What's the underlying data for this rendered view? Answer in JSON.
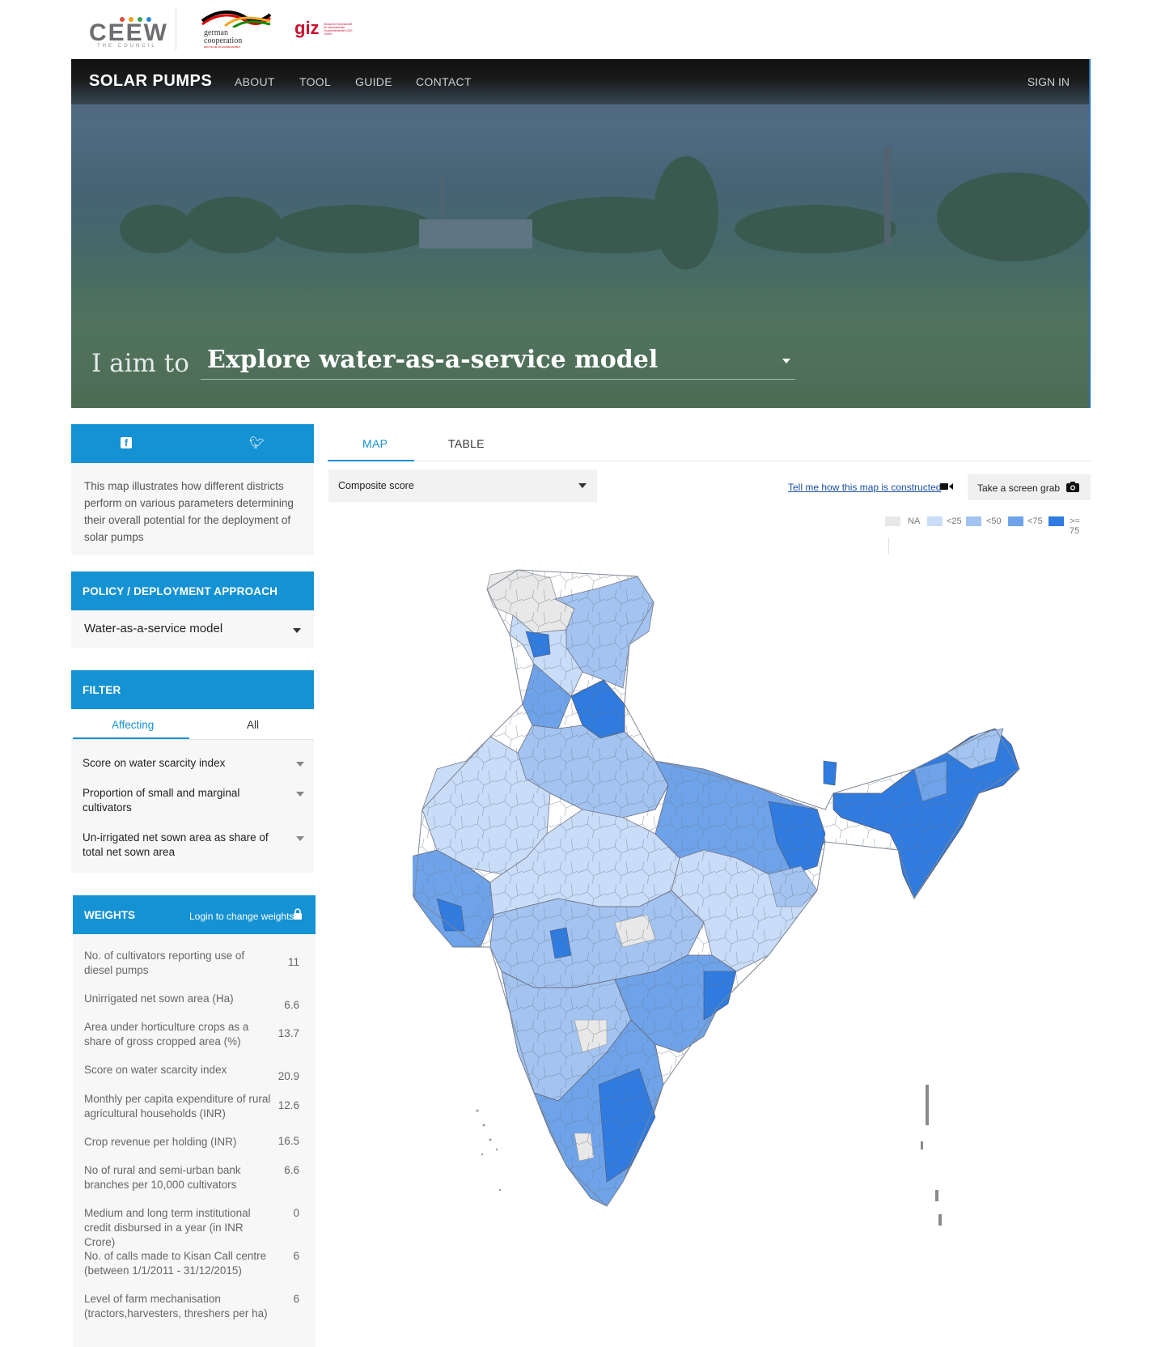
{
  "logos": {
    "ceew_word": "CEEW",
    "ceew_sub": "THE COUNCIL",
    "german_line1": "german",
    "german_line2": "cooperation",
    "german_small": "DEUTSCHE ZUSAMMENARBEIT",
    "giz_word": "giz",
    "giz_small": "Deutsche Gesellschaft für Internationale Zusammenarbeit (GIZ) GmbH"
  },
  "nav": {
    "brand": "SOLAR PUMPS",
    "items": [
      "ABOUT",
      "TOOL",
      "GUIDE",
      "CONTACT"
    ],
    "signin": "SIGN IN"
  },
  "hero": {
    "prefix": "I aim to",
    "selected_goal": "Explore water-as-a-service model"
  },
  "share": {
    "facebook_icon": "facebook-icon",
    "twitter_icon": "twitter-icon"
  },
  "intro_text": "This map illustrates how different districts perform on various parameters determining their overall potential for the deployment of solar pumps",
  "policy": {
    "heading": "POLICY / DEPLOYMENT APPROACH",
    "selected": "Water-as-a-service model"
  },
  "filter": {
    "heading": "FILTER",
    "tabs": [
      "Affecting",
      "All"
    ],
    "active_tab": "Affecting",
    "items": [
      "Score on water scarcity index",
      "Proportion of small and marginal cultivators",
      "Un-irrigated net sown area as share of total net sown area"
    ]
  },
  "weights": {
    "heading": "WEIGHTS",
    "login_label": "Login to change weights",
    "items": [
      {
        "label": "No. of cultivators reporting use of diesel pumps",
        "value": "11"
      },
      {
        "label": "Unirrigated net sown area (Ha)",
        "value": "6.6"
      },
      {
        "label": "Area under horticulture crops as a share of gross cropped area (%)",
        "value": "13.7"
      },
      {
        "label": "Score on water scarcity index",
        "value": "20.9"
      },
      {
        "label": "Monthly per capita expenditure of rural agricultural households (INR)",
        "value": "12.6"
      },
      {
        "label": "Crop revenue per holding (INR)",
        "value": "16.5"
      },
      {
        "label": "No of rural and semi-urban bank branches per 10,000 cultivators",
        "value": "6.6"
      },
      {
        "label": "Medium and long term institutional credit disbursed in a year (in INR Crore)",
        "value": "0"
      },
      {
        "label": "No. of calls made to Kisan Call centre (between 1/1/2011 - 31/12/2015)",
        "value": "6"
      },
      {
        "label": "Level of farm mechanisation (tractors,harvesters, threshers per ha)",
        "value": "6"
      }
    ]
  },
  "main": {
    "tabs": [
      "MAP",
      "TABLE"
    ],
    "active_tab": "MAP",
    "metric": "Composite score",
    "howto_link": "Tell me how this map is constructed",
    "screengrab_label": "Take a screen grab",
    "legend": [
      {
        "label": "NA",
        "color": "#e8e8e8"
      },
      {
        "label": "<25",
        "color": "#c9ddf8"
      },
      {
        "label": "<50",
        "color": "#a3c4f1"
      },
      {
        "label": "<75",
        "color": "#6ea3ea"
      },
      {
        "label": ">= 75",
        "color": "#2f7be0"
      }
    ]
  },
  "colors": {
    "accent": "#1592d3",
    "link": "#1a4fa0"
  }
}
